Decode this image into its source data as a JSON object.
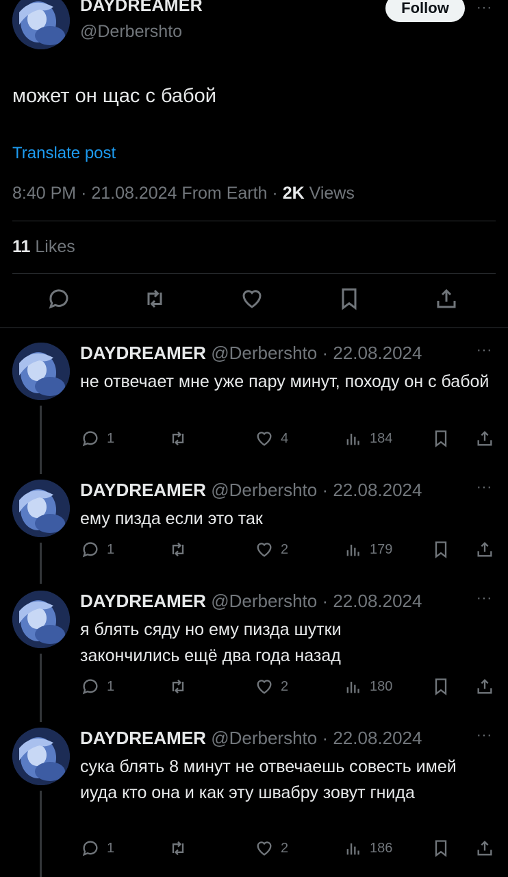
{
  "post": {
    "author_name": "DAYDREAMER",
    "author_handle": "@Derbershto",
    "follow_label": "Follow",
    "more_label": "···",
    "text": "может он щас с бабой",
    "translate_label": "Translate post",
    "time": "8:40 PM",
    "date": "21.08.2024",
    "source": "From Earth",
    "views_count": "2K",
    "views_label": "Views",
    "likes_count": "11",
    "likes_label": "Likes",
    "sep": "·"
  },
  "replies": [
    {
      "name": "DAYDREAMER",
      "handle": "@Derbershto",
      "date": "· 22.08.2024",
      "more": "···",
      "text": "не отвечает мне уже пару минут, походу он с бабой",
      "replies": "1",
      "likes": "4",
      "views": "184"
    },
    {
      "name": "DAYDREAMER",
      "handle": "@Derbershto",
      "date": "· 22.08.2024",
      "more": "···",
      "text": "ему пизда если это так",
      "replies": "1",
      "likes": "2",
      "views": "179"
    },
    {
      "name": "DAYDREAMER",
      "handle": "@Derbershto",
      "date": "· 22.08.2024",
      "more": "···",
      "text": "я блять сяду но ему пизда шутки закончились ещё два года назад",
      "replies": "1",
      "likes": "2",
      "views": "180"
    },
    {
      "name": "DAYDREAMER",
      "handle": "@Derbershto",
      "date": "· 22.08.2024",
      "more": "···",
      "text": "сука блять 8 минут не отвечаешь совесть имей иуда кто она и как эту швабру зовут гнида",
      "replies": "1",
      "likes": "2",
      "views": "186"
    }
  ],
  "icons": {
    "reply": "speech-bubble-icon",
    "repost": "repost-icon",
    "like": "heart-icon",
    "views": "bar-chart-icon",
    "bookmark": "bookmark-icon",
    "share": "share-icon"
  },
  "colors": {
    "background": "#000000",
    "text": "#e7e9ea",
    "muted": "#71767b",
    "link": "#1d9bf0",
    "divider": "#2f3336",
    "follow_bg": "#eff3f4"
  }
}
